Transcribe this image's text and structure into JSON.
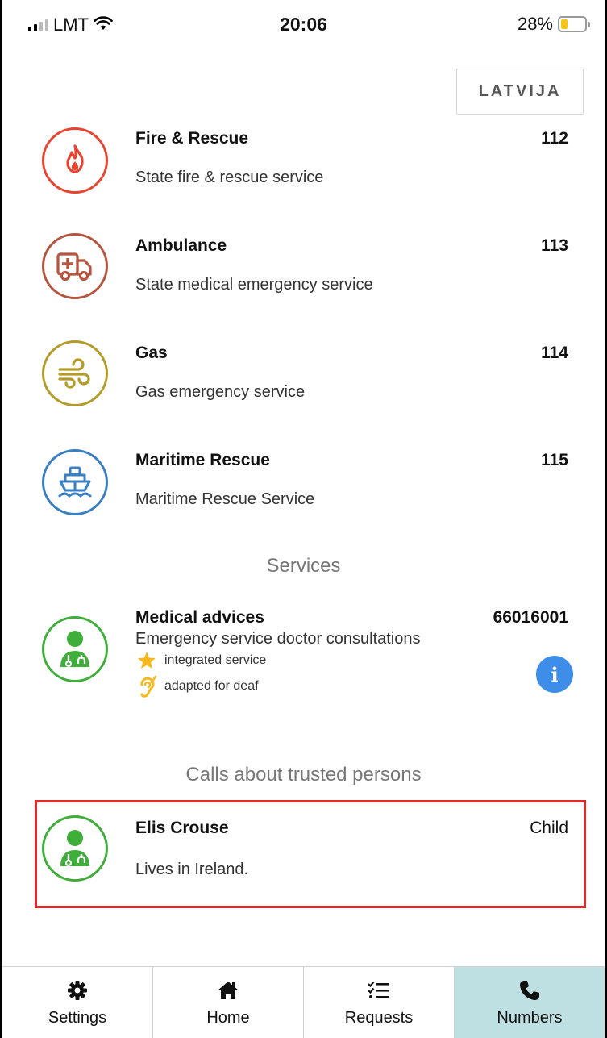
{
  "status_bar": {
    "carrier": "LMT",
    "time": "20:06",
    "battery": "28%",
    "battery_level": 0.28
  },
  "country_button": {
    "label": "LATVIJA"
  },
  "emergency": [
    {
      "title": "Fire & Rescue",
      "subtitle": "State fire & rescue service",
      "number": "112",
      "icon": "fire-icon",
      "color": "#e8432e"
    },
    {
      "title": "Ambulance",
      "subtitle": "State medical emergency service",
      "number": "113",
      "icon": "ambulance-icon",
      "color": "#b5553f"
    },
    {
      "title": "Gas",
      "subtitle": "Gas emergency service",
      "number": "114",
      "icon": "wind-icon",
      "color": "#b39b28"
    },
    {
      "title": "Maritime Rescue",
      "subtitle": "Maritime Rescue Service",
      "number": "115",
      "icon": "ship-icon",
      "color": "#3a7fc2"
    }
  ],
  "services": {
    "heading": "Services",
    "item": {
      "title": "Medical advices",
      "subtitle": "Emergency service doctor consultations",
      "number": "66016001",
      "features": [
        "integrated service",
        "adapted for deaf"
      ],
      "icon": "doctor-icon",
      "color": "#3fae3a"
    }
  },
  "trusted": {
    "heading": "Calls about trusted persons",
    "item": {
      "name": "Elis Crouse",
      "relation": "Child",
      "note": "Lives in Ireland.",
      "icon": "doctor-icon",
      "color": "#3fae3a"
    }
  },
  "tabs": [
    {
      "label": "Settings",
      "icon": "gear-icon"
    },
    {
      "label": "Home",
      "icon": "home-icon"
    },
    {
      "label": "Requests",
      "icon": "checklist-icon"
    },
    {
      "label": "Numbers",
      "icon": "phone-icon",
      "active": true
    }
  ]
}
